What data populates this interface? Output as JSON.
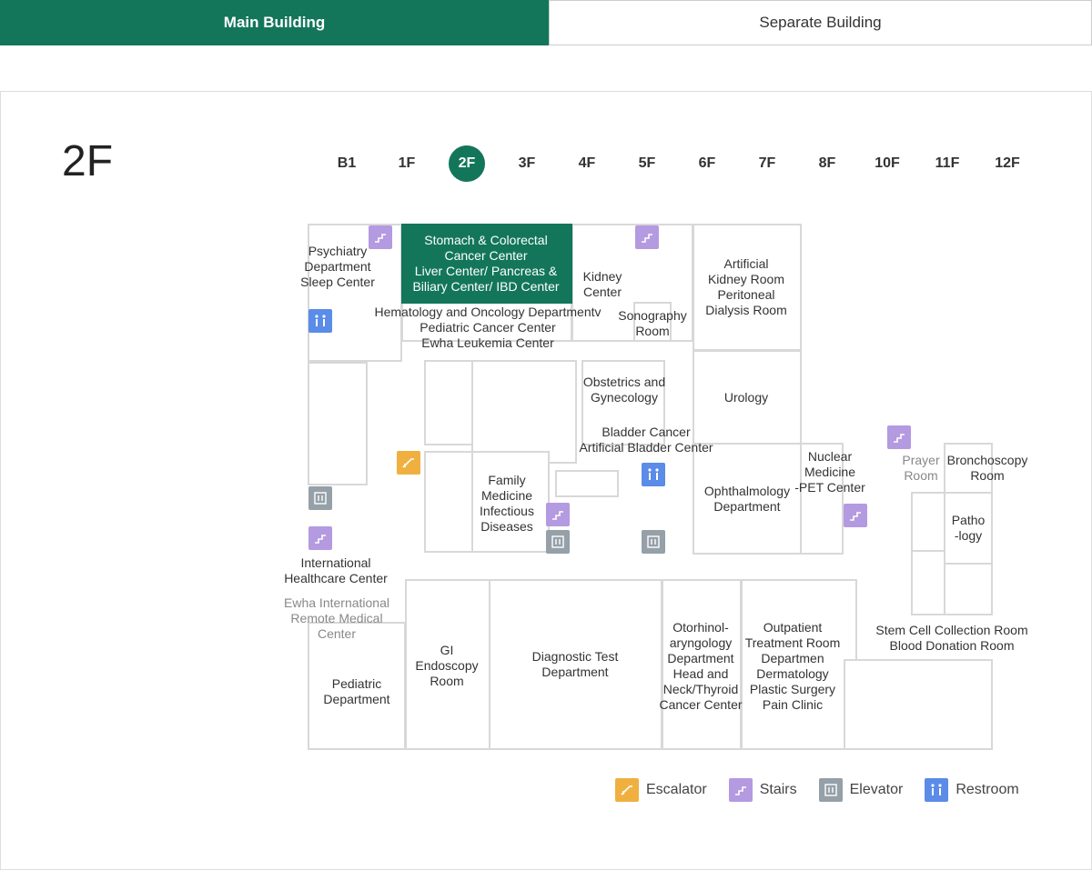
{
  "tabs": [
    {
      "label": "Main Building",
      "active": true
    },
    {
      "label": "Separate Building",
      "active": false
    }
  ],
  "floor_title": "2F",
  "floors": [
    "B1",
    "1F",
    "2F",
    "3F",
    "4F",
    "5F",
    "6F",
    "7F",
    "8F",
    "10F",
    "11F",
    "12F"
  ],
  "active_floor": "2F",
  "colors": {
    "accent": "#13765a",
    "stairs": "#b49ae0",
    "elevator": "#95a0a8",
    "restroom": "#5a8ce8",
    "escalator": "#f0b040"
  },
  "rooms": {
    "psychiatry": [
      "Psychiatry",
      "Department",
      "Sleep Center"
    ],
    "stomach": [
      "Stomach & Colorectal",
      "Cancer Center",
      "Liver Center/ Pancreas &",
      "Biliary Center/ IBD Center"
    ],
    "hematology": [
      "Hematology and Oncology Departmentv",
      "Pediatric Cancer Center",
      "Ewha Leukemia Center"
    ],
    "kidney": [
      "Kidney",
      "Center"
    ],
    "sonography": [
      "Sonography",
      "Room"
    ],
    "artificial_kidney": [
      "Artificial",
      "Kidney Room",
      "Peritoneal",
      "Dialysis Room"
    ],
    "obstetrics": [
      "Obstetrics and",
      "Gynecology"
    ],
    "urology": [
      "Urology"
    ],
    "bladder": [
      "Bladder Cancer",
      "Artificial Bladder Center"
    ],
    "family": [
      "Family",
      "Medicine",
      "Infectious",
      "Diseases"
    ],
    "ophthalmology": [
      "Ophthalmology",
      "Department"
    ],
    "nuclear": [
      "Nuclear",
      "Medicine",
      "-PET Center"
    ],
    "prayer": [
      "Prayer",
      "Room"
    ],
    "bronchoscopy": [
      "Bronchoscopy",
      "Room"
    ],
    "pathology": [
      "Patho",
      "-logy"
    ],
    "international": [
      "International",
      "Healthcare Center"
    ],
    "remote": [
      "Ewha International",
      "Remote Medical",
      "Center"
    ],
    "gi": [
      "GI",
      "Endoscopy",
      "Room"
    ],
    "diagnostic": [
      "Diagnostic Test",
      "Department"
    ],
    "ent": [
      "Otorhinol-",
      "aryngology",
      "Department",
      "Head and",
      "Neck/Thyroid",
      "Cancer Center"
    ],
    "outpatient": [
      "Outpatient",
      "Treatment Room",
      "Departmen",
      "Dermatology",
      "Plastic Surgery",
      "Pain Clinic"
    ],
    "stemcell": [
      "Stem Cell Collection Room",
      "Blood Donation Room"
    ],
    "pediatric": [
      "Pediatric",
      "Department"
    ]
  },
  "legend": [
    {
      "icon": "escalator-icon",
      "label": "Escalator"
    },
    {
      "icon": "stairs-icon",
      "label": "Stairs"
    },
    {
      "icon": "elevator-icon",
      "label": "Elevator"
    },
    {
      "icon": "restroom-icon",
      "label": "Restroom"
    }
  ]
}
